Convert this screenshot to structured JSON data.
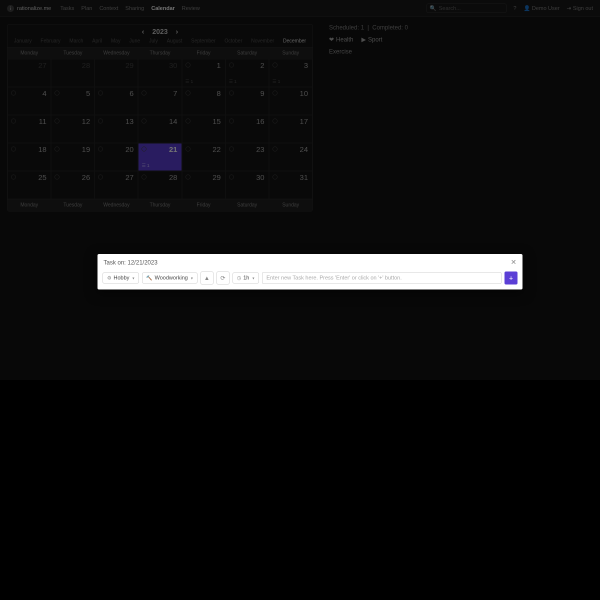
{
  "brand": "rationalize.me",
  "nav": {
    "links": [
      "Tasks",
      "Plan",
      "Context",
      "Sharing",
      "Calendar",
      "Review"
    ],
    "active": 4,
    "search_placeholder": "Search...",
    "user_label": "Demo User",
    "signout_label": "Sign out"
  },
  "calendar": {
    "year": "2023",
    "months": [
      "January",
      "February",
      "March",
      "April",
      "May",
      "June",
      "July",
      "August",
      "September",
      "October",
      "November",
      "December"
    ],
    "active_month_index": 11,
    "weekdays": [
      "Monday",
      "Tuesday",
      "Wednesday",
      "Thursday",
      "Friday",
      "Saturday",
      "Sunday"
    ],
    "cells": [
      {
        "n": "27",
        "other": true
      },
      {
        "n": "28",
        "other": true
      },
      {
        "n": "29",
        "other": true
      },
      {
        "n": "30",
        "other": true
      },
      {
        "n": "1",
        "meta": "1"
      },
      {
        "n": "2",
        "meta": "1"
      },
      {
        "n": "3",
        "meta": "1"
      },
      {
        "n": "4"
      },
      {
        "n": "5"
      },
      {
        "n": "6"
      },
      {
        "n": "7"
      },
      {
        "n": "8"
      },
      {
        "n": "9"
      },
      {
        "n": "10"
      },
      {
        "n": "11"
      },
      {
        "n": "12"
      },
      {
        "n": "13"
      },
      {
        "n": "14"
      },
      {
        "n": "15"
      },
      {
        "n": "16"
      },
      {
        "n": "17"
      },
      {
        "n": "18"
      },
      {
        "n": "19"
      },
      {
        "n": "20"
      },
      {
        "n": "21",
        "selected": true,
        "meta": "1"
      },
      {
        "n": "22"
      },
      {
        "n": "23"
      },
      {
        "n": "24"
      },
      {
        "n": "25"
      },
      {
        "n": "26"
      },
      {
        "n": "27"
      },
      {
        "n": "28"
      },
      {
        "n": "29"
      },
      {
        "n": "30"
      },
      {
        "n": "31"
      }
    ]
  },
  "side": {
    "scheduled_label": "Scheduled:",
    "scheduled_count": "1",
    "completed_label": "Completed:",
    "completed_count": "0",
    "categories": [
      {
        "icon": "❤",
        "label": "Health"
      },
      {
        "icon": "▶",
        "label": "Sport"
      }
    ],
    "item_label": "Exercise"
  },
  "modal": {
    "title": "Task on: 12/21/2023",
    "category_chip": "Hobby",
    "subcategory_chip": "Woodworking",
    "duration_chip": "1h",
    "input_placeholder": "Enter new Task here. Press 'Enter' or click on '+' button."
  }
}
